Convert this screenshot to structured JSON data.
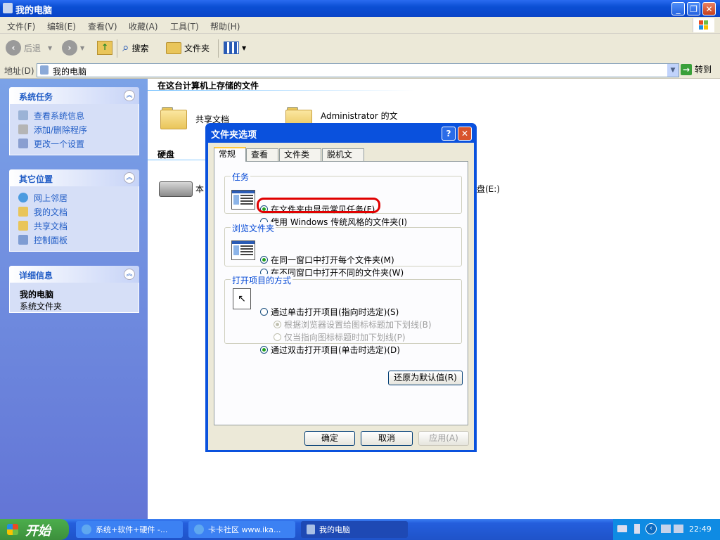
{
  "window": {
    "title": "我的电脑"
  },
  "menu": [
    "文件(F)",
    "编辑(E)",
    "查看(V)",
    "收藏(A)",
    "工具(T)",
    "帮助(H)"
  ],
  "toolbar": {
    "back": "后退",
    "search": "搜索",
    "folders": "文件夹"
  },
  "address": {
    "label": "地址(D)",
    "value": "我的电脑",
    "go": "转到"
  },
  "leftpane": {
    "system_tasks": {
      "title": "系统任务",
      "items": [
        "查看系统信息",
        "添加/删除程序",
        "更改一个设置"
      ]
    },
    "other_places": {
      "title": "其它位置",
      "items": [
        "网上邻居",
        "我的文档",
        "共享文档",
        "控制面板"
      ]
    },
    "details": {
      "title": "详细信息",
      "name": "我的电脑",
      "desc": "系统文件夹"
    }
  },
  "content": {
    "stored_title": "在这台计算机上存储的文件",
    "folders": [
      "共享文档",
      "Administrator 的文档"
    ],
    "disk_title": "硬盘",
    "disk_left_label": "本",
    "disk_right_label": "盘(E:)"
  },
  "dialog": {
    "title": "文件夹选项",
    "tabs": [
      "常规",
      "查看",
      "文件类型",
      "脱机文件"
    ],
    "tasks_group": "任务",
    "tasks_opt1": "在文件夹中显示常见任务(F)",
    "tasks_opt2": "使用 Windows 传统风格的文件夹(I)",
    "browse_group": "浏览文件夹",
    "browse_opt1": "在同一窗口中打开每个文件夹(M)",
    "browse_opt2": "在不同窗口中打开不同的文件夹(W)",
    "click_group": "打开项目的方式",
    "click_opt1": "通过单击打开项目(指向时选定)(S)",
    "click_sub1": "根据浏览器设置给图标标题加下划线(B)",
    "click_sub2": "仅当指向图标标题时加下划线(P)",
    "click_opt2": "通过双击打开项目(单击时选定)(D)",
    "restore": "还原为默认值(R)",
    "ok": "确定",
    "cancel": "取消",
    "apply": "应用(A)"
  },
  "taskbar": {
    "start": "开始",
    "tasks": [
      "系统+软件+硬件 -...",
      "卡卡社区 www.ika...",
      "我的电脑"
    ],
    "clock": "22:49"
  }
}
